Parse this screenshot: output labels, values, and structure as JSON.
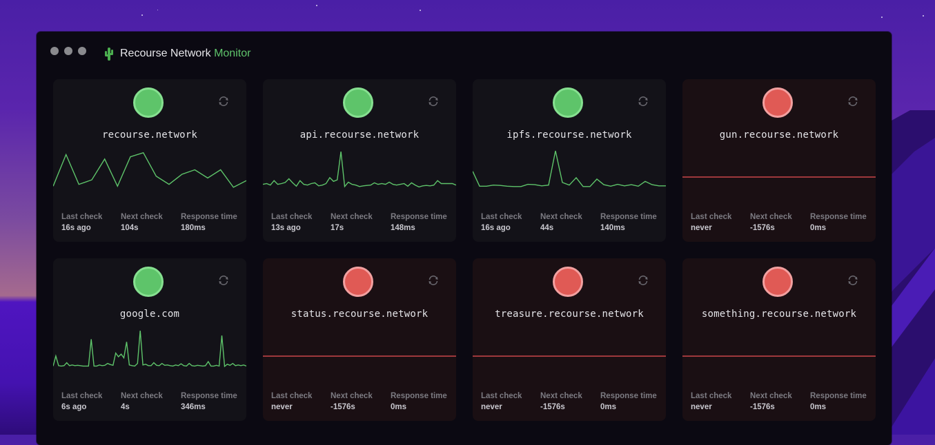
{
  "window": {
    "title_main": "Recourse Network",
    "title_accent": "Monitor",
    "logo_icon": "cactus-icon"
  },
  "labels": {
    "last_check": "Last check",
    "next_check": "Next check",
    "response_time": "Response time"
  },
  "colors": {
    "up": "#5ec46a",
    "up_border": "#86e090",
    "down": "#e05a55",
    "down_border": "#f2a0a0",
    "sparkline_up": "#5ec46a",
    "sparkline_down": "#c9464a",
    "accent": "#5fc46b"
  },
  "monitors": [
    {
      "host": "recourse.network",
      "status": "up",
      "last_check": "16s ago",
      "next_check": "104s",
      "response_time": "180ms",
      "history": [
        0.05,
        0.9,
        0.1,
        0.22,
        0.78,
        0.05,
        0.84,
        0.95,
        0.32,
        0.1,
        0.37,
        0.49,
        0.27,
        0.49,
        0.02,
        0.2
      ]
    },
    {
      "host": "api.recourse.network",
      "status": "up",
      "last_check": "13s ago",
      "next_check": "17s",
      "response_time": "148ms",
      "history": [
        0.1,
        0.12,
        0.08,
        0.2,
        0.1,
        0.12,
        0.15,
        0.25,
        0.14,
        0.05,
        0.2,
        0.1,
        0.08,
        0.12,
        0.14,
        0.06,
        0.08,
        0.12,
        0.28,
        0.18,
        0.22,
        0.98,
        0.04,
        0.16,
        0.1,
        0.08,
        0.04,
        0.06,
        0.07,
        0.08,
        0.14,
        0.1,
        0.12,
        0.1,
        0.16,
        0.1,
        0.08,
        0.1,
        0.12,
        0.05,
        0.14,
        0.08,
        0.03,
        0.06,
        0.07,
        0.06,
        0.08,
        0.2,
        0.12,
        0.12,
        0.12,
        0.12,
        0.08
      ]
    },
    {
      "host": "ipfs.recourse.network",
      "status": "up",
      "last_check": "16s ago",
      "next_check": "44s",
      "response_time": "140ms",
      "history": [
        0.45,
        0.05,
        0.05,
        0.08,
        0.07,
        0.05,
        0.04,
        0.04,
        0.1,
        0.09,
        0.06,
        0.08,
        1.0,
        0.15,
        0.08,
        0.28,
        0.04,
        0.04,
        0.24,
        0.09,
        0.05,
        0.1,
        0.06,
        0.09,
        0.05,
        0.18,
        0.09,
        0.06,
        0.06
      ]
    },
    {
      "host": "gun.recourse.network",
      "status": "down",
      "last_check": "never",
      "next_check": "-1576s",
      "response_time": "0ms",
      "history": []
    },
    {
      "host": "google.com",
      "status": "up",
      "last_check": "6s ago",
      "next_check": "4s",
      "response_time": "346ms",
      "history": [
        0.03,
        0.3,
        0.04,
        0.03,
        0.04,
        0.12,
        0.04,
        0.06,
        0.04,
        0.05,
        0.04,
        0.03,
        0.03,
        0.03,
        0.75,
        0.03,
        0.03,
        0.06,
        0.04,
        0.05,
        0.1,
        0.07,
        0.05,
        0.38,
        0.28,
        0.35,
        0.25,
        0.68,
        0.06,
        0.04,
        0.03,
        0.1,
        0.98,
        0.06,
        0.08,
        0.04,
        0.04,
        0.12,
        0.05,
        0.04,
        0.1,
        0.05,
        0.06,
        0.04,
        0.03,
        0.06,
        0.04,
        0.09,
        0.04,
        0.03,
        0.1,
        0.04,
        0.03,
        0.05,
        0.04,
        0.03,
        0.04,
        0.15,
        0.03,
        0.03,
        0.05,
        0.03,
        0.85,
        0.02,
        0.08,
        0.05,
        0.1,
        0.04,
        0.06,
        0.04,
        0.06,
        0.03
      ]
    },
    {
      "host": "status.recourse.network",
      "status": "down",
      "last_check": "never",
      "next_check": "-1576s",
      "response_time": "0ms",
      "history": []
    },
    {
      "host": "treasure.recourse.network",
      "status": "down",
      "last_check": "never",
      "next_check": "-1576s",
      "response_time": "0ms",
      "history": []
    },
    {
      "host": "something.recourse.network",
      "status": "down",
      "last_check": "never",
      "next_check": "-1576s",
      "response_time": "0ms",
      "history": []
    }
  ]
}
